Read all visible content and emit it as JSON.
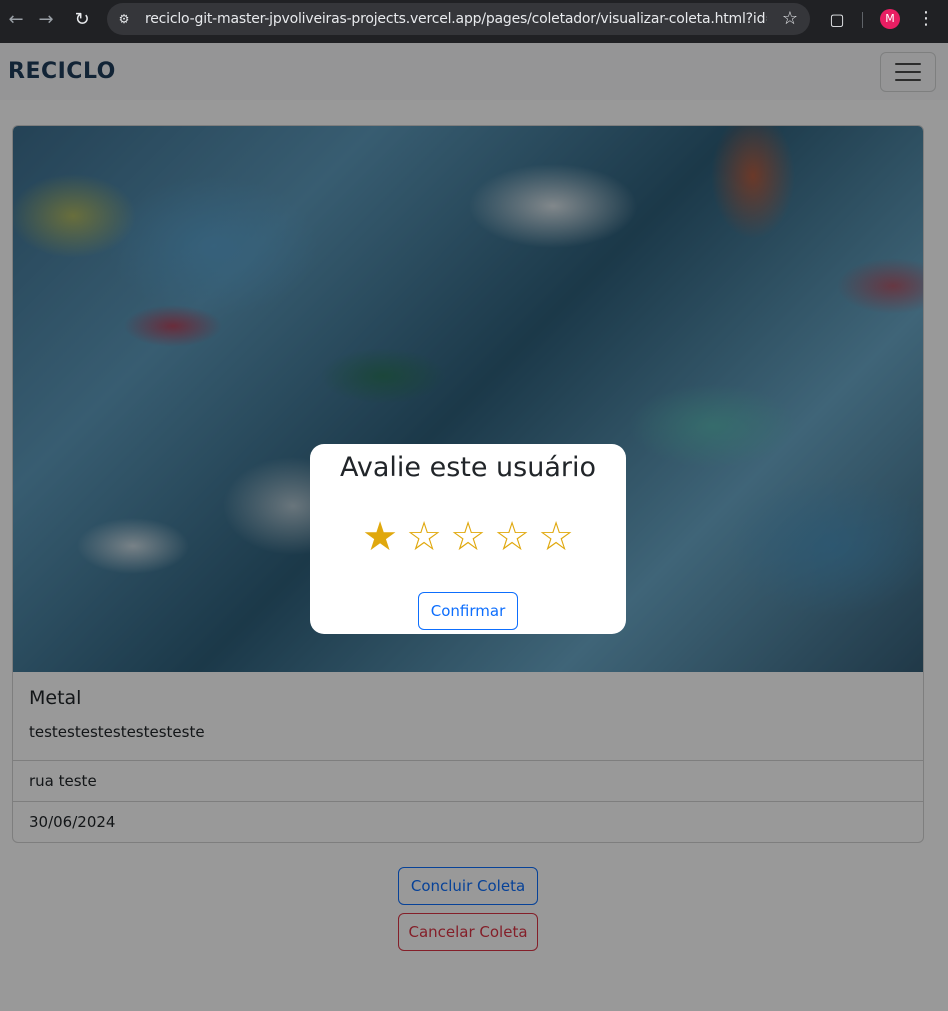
{
  "browser": {
    "url": "reciclo-git-master-jpvoliveiras-projects.vercel.app/pages/coletador/visualizar-coleta.html?id=t-q...",
    "profile_initial": "M",
    "profile_color": "#e91e63"
  },
  "navbar": {
    "brand": "RECICLO"
  },
  "collection": {
    "title": "Metal",
    "description": "testestestestestesteste",
    "address": "rua teste",
    "date": "30/06/2024"
  },
  "actions": {
    "complete_label": "Concluir Coleta",
    "cancel_label": "Cancelar Coleta"
  },
  "rating_modal": {
    "title": "Avalie este usuário",
    "rating": 1,
    "max_rating": 5,
    "stars": [
      "★",
      "☆",
      "☆",
      "☆",
      "☆"
    ],
    "confirm_label": "Confirmar"
  },
  "colors": {
    "primary": "#0d6efd",
    "danger": "#dc3545",
    "star": "#e0a80d"
  }
}
